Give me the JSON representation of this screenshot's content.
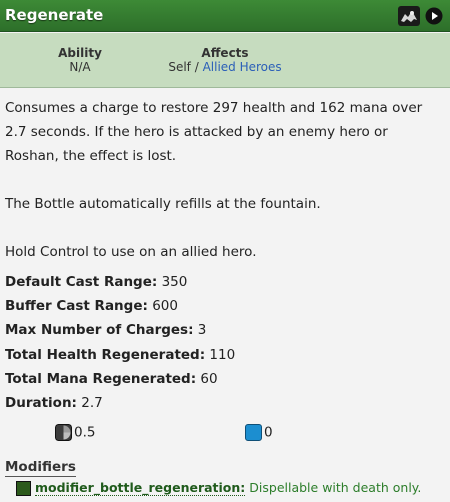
{
  "header": {
    "title": "Regenerate"
  },
  "info": {
    "ability_label": "Ability",
    "ability_value": "N/A",
    "affects_label": "Affects",
    "affects_self": "Self",
    "affects_sep": " / ",
    "affects_link": "Allied Heroes"
  },
  "description": [
    "Consumes a charge to restore 297 health and 162 mana over 2.7 seconds. If the hero is attacked by an enemy hero or Roshan, the effect is lost.",
    "The Bottle automatically refills at the fountain.",
    "Hold Control to use on an allied hero."
  ],
  "stats": [
    {
      "label": "Default Cast Range:",
      "value": "350"
    },
    {
      "label": "Buffer Cast Range:",
      "value": "600"
    },
    {
      "label": "Max Number of Charges:",
      "value": "3"
    },
    {
      "label": "Total Health Regenerated:",
      "value": "110"
    },
    {
      "label": "Total Mana Regenerated:",
      "value": "60"
    },
    {
      "label": "Duration:",
      "value": "2.7"
    }
  ],
  "costs": {
    "cooldown": "0.5",
    "mana": "0"
  },
  "modifiers": {
    "title": "Modifiers",
    "items": [
      {
        "name": "modifier_bottle_regeneration:",
        "note": "Dispellable with death only."
      }
    ]
  },
  "icons": {
    "hero": "hero-portrait-icon",
    "play": "play-icon",
    "cooldown": "cooldown-icon",
    "mana": "mana-icon",
    "modifier": "modifier-icon"
  },
  "colors": {
    "title_bar": "#2d6f2a",
    "info_band": "#c6dcbf",
    "link": "#2b5fb8",
    "modifier_name": "#1f5a1b",
    "modifier_note": "#2c7d2a"
  }
}
